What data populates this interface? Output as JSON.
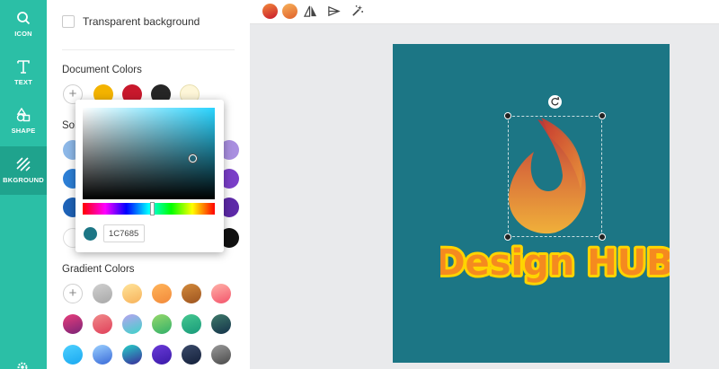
{
  "nav": {
    "items": [
      {
        "label": "ICON",
        "icon": "search-icon"
      },
      {
        "label": "TEXT",
        "icon": "text-icon"
      },
      {
        "label": "SHAPE",
        "icon": "shape-icon"
      },
      {
        "label": "BKGROUND",
        "icon": "background-icon",
        "active": true
      }
    ],
    "settings_icon": "gear-icon"
  },
  "panel": {
    "transparent_label": "Transparent background",
    "transparent_checked": false,
    "document_colors_title": "Document Colors",
    "document_colors": [
      "#f3b300",
      "#c8182c",
      "#262626",
      "#fdf6d8"
    ],
    "solid_colors_title": "Sol",
    "solid_colors": [
      {
        "color": "#8db8e8"
      },
      {
        "color": "#a98fe0"
      },
      {
        "color": "#2d7fd6"
      },
      {
        "color": "#7a3ec8"
      },
      {
        "color": "#1e63b8"
      },
      {
        "color": "#5d29a8"
      },
      {
        "color": "#ffffff"
      },
      {
        "color": "#111111"
      }
    ],
    "gradient_colors_title": "Gradient Colors",
    "gradient_colors": [
      [
        "#d0d0d0",
        "#a8a8a8"
      ],
      [
        "#ffe49a",
        "#f7b25b"
      ],
      [
        "#ffb45a",
        "#f28a3b"
      ],
      [
        "#d38a3b",
        "#9d5420"
      ],
      [
        "#ffb2a8",
        "#f3546b"
      ],
      [
        "#e83d7a",
        "#7b2478"
      ],
      [
        "#f08a8a",
        "#e0405a"
      ],
      [
        "#b8a2f0",
        "#3ed3c8"
      ],
      [
        "#96d86a",
        "#32b06a"
      ],
      [
        "#46c890",
        "#189a7a"
      ],
      [
        "#3e7a6a",
        "#14324a"
      ],
      [
        "#4dd0ff",
        "#1aa8f0"
      ],
      [
        "#9ad0ff",
        "#3a6ad8"
      ],
      [
        "#26d0c8",
        "#3a2a9a"
      ],
      [
        "#6a3ad8",
        "#3a1aa8"
      ],
      [
        "#3a4a6a",
        "#14203a"
      ],
      [
        "#9a9a9a",
        "#4a4a4a"
      ]
    ]
  },
  "picker": {
    "hex_value": "1C7685",
    "current_color": "#1c7685"
  },
  "toolbar": {
    "swatches": [
      [
        "#f28a3b",
        "#c8182c"
      ],
      [
        "#f7b25b",
        "#e0602a"
      ]
    ],
    "icons": [
      "flip-horizontal-icon",
      "align-icon",
      "magic-wand-icon"
    ]
  },
  "canvas": {
    "background": "#1c7685",
    "logo_text": "Design HUB",
    "text_fill": "#f58a1f",
    "text_outline": "#ffd400"
  }
}
